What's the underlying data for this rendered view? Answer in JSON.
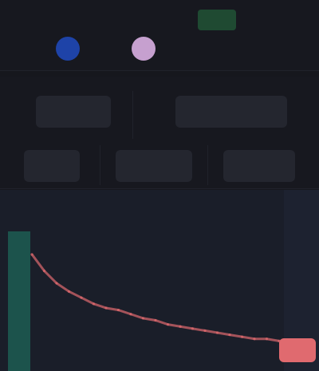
{
  "header": {
    "pair": "",
    "price": "",
    "change": "",
    "sub_label": ""
  },
  "stats": {
    "row1": [
      "",
      ""
    ],
    "row2": [
      "",
      "",
      ""
    ]
  },
  "chart": {
    "axis_label": "",
    "price_tag": "",
    "colors": {
      "background": "#1a1e29",
      "line": "#e06a6f",
      "volume": "#1f7f6a",
      "accent_positive": "#6fd49a",
      "accent_negative": "#e06a6f"
    }
  },
  "chart_data": {
    "type": "line",
    "x": [
      0,
      1,
      2,
      3,
      4,
      5,
      6,
      7,
      8,
      9,
      10,
      11,
      12,
      13,
      14,
      15,
      16,
      17,
      18,
      19,
      20
    ],
    "y": [
      80,
      72,
      66,
      62,
      59,
      56,
      54,
      53,
      51,
      49,
      48,
      46,
      45,
      44,
      43,
      42,
      41,
      40,
      39,
      39,
      38
    ],
    "title": "",
    "xlabel": "",
    "ylabel": "",
    "grid": false
  }
}
